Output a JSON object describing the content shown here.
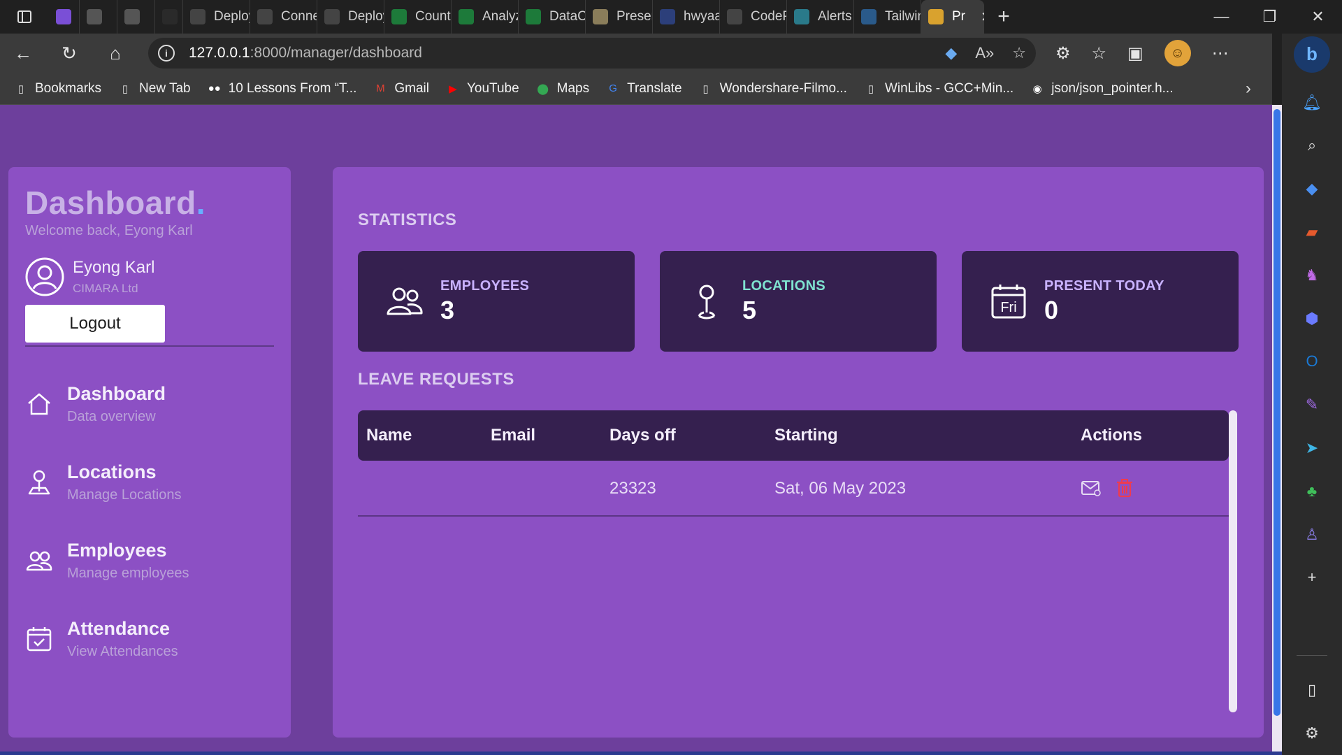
{
  "browser": {
    "tabs": [
      {
        "label": "",
        "fav_color": "#7a4fd6",
        "icon": "app-icon"
      },
      {
        "label": "",
        "fav_color": "#555555",
        "icon": "page-icon"
      },
      {
        "label": "",
        "fav_color": "#555555",
        "icon": "code-icon"
      },
      {
        "label": "",
        "fav_color": "#2a2a2a",
        "icon": "c-icon"
      },
      {
        "label": "Deploy",
        "fav_color": "#444444",
        "icon": "deploy-icon"
      },
      {
        "label": "Conne",
        "fav_color": "#444444",
        "icon": "connect-icon"
      },
      {
        "label": "Deploy",
        "fav_color": "#444444",
        "icon": "chip-icon"
      },
      {
        "label": "Counti",
        "fav_color": "#1d7a3a",
        "icon": "pycharm-icon"
      },
      {
        "label": "Analyz",
        "fav_color": "#1d7a3a",
        "icon": "pycharm-icon"
      },
      {
        "label": "DataC",
        "fav_color": "#1d7a3a",
        "icon": "pycharm-icon"
      },
      {
        "label": "Presen",
        "fav_color": "#8a7d5a",
        "icon": "present-icon"
      },
      {
        "label": "hwyaa",
        "fav_color": "#2c3f7a",
        "icon": "hwyaa-icon"
      },
      {
        "label": "CodeP",
        "fav_color": "#444444",
        "icon": "codepen-icon"
      },
      {
        "label": "Alerts",
        "fav_color": "#2a7a8a",
        "icon": "tailwind-icon"
      },
      {
        "label": "Tailwin",
        "fav_color": "#2a5a8a",
        "icon": "tailwind-t-icon"
      },
      {
        "label": "Pr",
        "fav_color": "#d9a22e",
        "icon": "site-icon",
        "active": true
      }
    ],
    "new_tab": "+",
    "url_host": "127.0.0.1",
    "url_rest": ":8000/manager/dashboard",
    "bookmarks": [
      {
        "label": "Bookmarks",
        "icon": "page-icon",
        "color": "#dddddd"
      },
      {
        "label": "New Tab",
        "icon": "page-icon",
        "color": "#dddddd"
      },
      {
        "label": "10 Lessons From “T...",
        "icon": "medium-icon",
        "color": "#ffffff"
      },
      {
        "label": "Gmail",
        "icon": "gmail-icon",
        "color": "#e44134"
      },
      {
        "label": "YouTube",
        "icon": "youtube-icon",
        "color": "#ff0000"
      },
      {
        "label": "Maps",
        "icon": "maps-icon",
        "color": "#34a853"
      },
      {
        "label": "Translate",
        "icon": "translate-icon",
        "color": "#4285f4"
      },
      {
        "label": "Wondershare-Filmo...",
        "icon": "page-icon",
        "color": "#dddddd"
      },
      {
        "label": "WinLibs - GCC+Min...",
        "icon": "page-icon",
        "color": "#dddddd"
      },
      {
        "label": "json/json_pointer.h...",
        "icon": "github-icon",
        "color": "#ffffff"
      }
    ]
  },
  "sidebar": {
    "brand": "Dashboard",
    "brand_dot": ".",
    "welcome": "Welcome back, Eyong Karl",
    "user_name": "Eyong Karl",
    "company": "CIMARA Ltd",
    "logout_label": "Logout",
    "nav": [
      {
        "title": "Dashboard",
        "subtitle": "Data overview",
        "icon": "home-icon"
      },
      {
        "title": "Locations",
        "subtitle": "Manage Locations",
        "icon": "location-pin-icon"
      },
      {
        "title": "Employees",
        "subtitle": "Manage employees",
        "icon": "people-icon"
      },
      {
        "title": "Attendance",
        "subtitle": "View Attendances",
        "icon": "calendar-check-icon"
      }
    ]
  },
  "main": {
    "statistics_title": "STATISTICS",
    "stats": [
      {
        "label": "EMPLOYEES",
        "value": "3",
        "color": "#c9b2ff",
        "icon": "people-icon"
      },
      {
        "label": "LOCATIONS",
        "value": "5",
        "color": "#7fe3d0",
        "icon": "location-pin-icon"
      },
      {
        "label": "PRESENT TODAY",
        "value": "0",
        "color": "#c9b2ff",
        "icon": "calendar-icon",
        "calendar_text": "Fri"
      }
    ],
    "leave_title": "LEAVE REQUESTS",
    "table": {
      "headers": [
        "Name",
        "Email",
        "Days off",
        "Starting",
        "Actions"
      ],
      "rows": [
        {
          "name": "",
          "email": "",
          "days_off": "23323",
          "starting": "Sat, 06 May 2023"
        }
      ]
    }
  }
}
